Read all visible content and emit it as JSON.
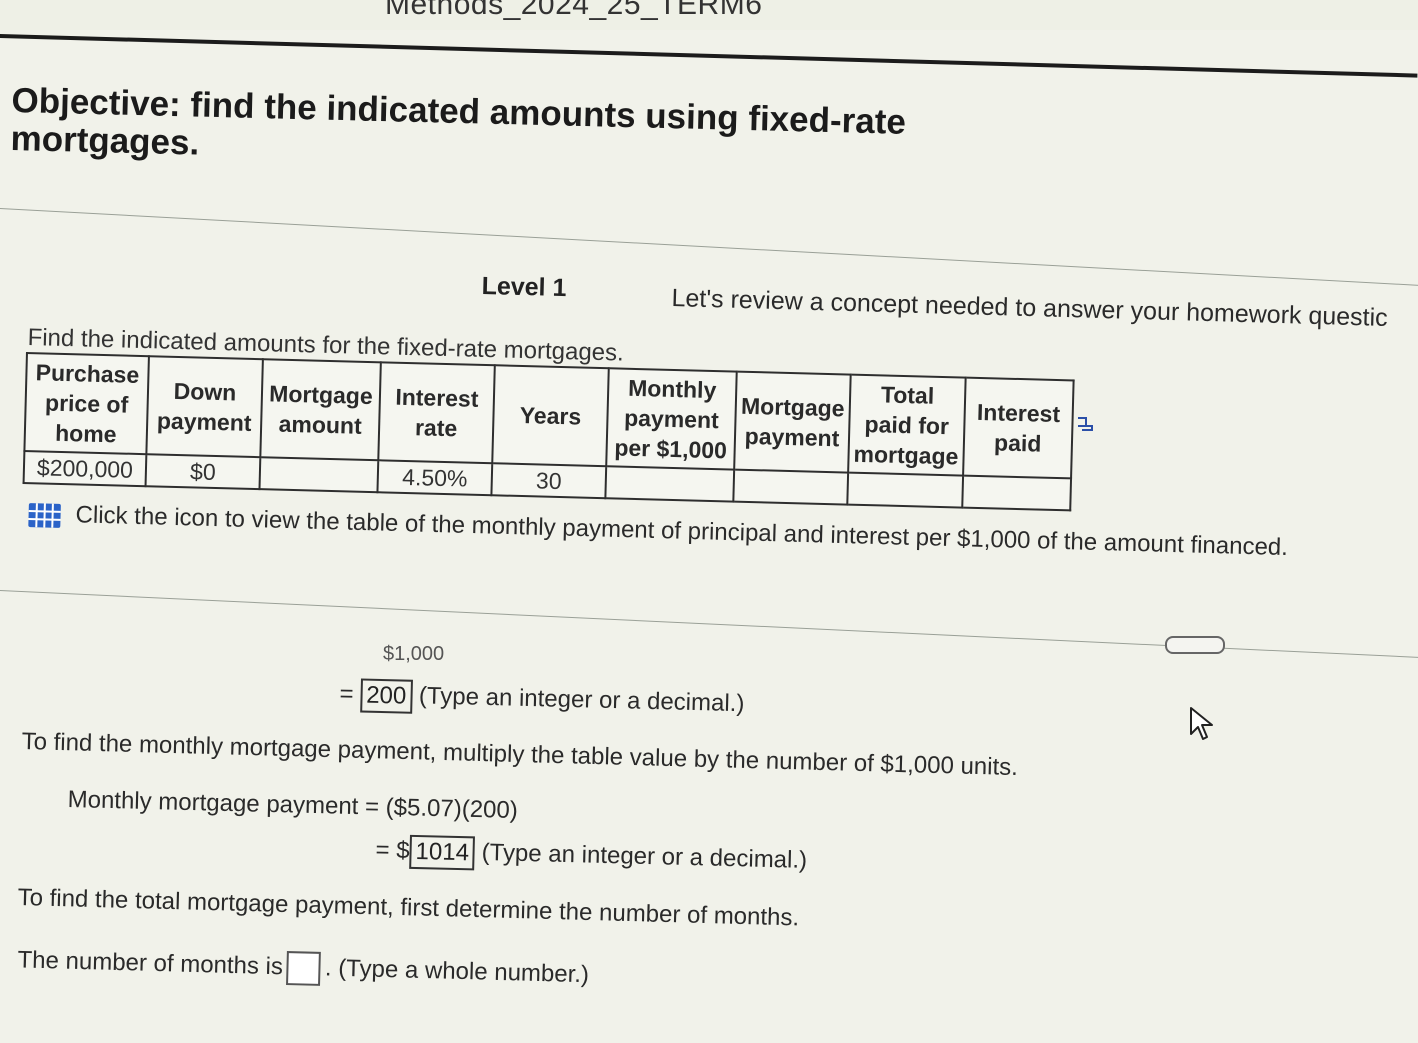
{
  "header": {
    "course_title": "Methods_2024_25_TERM6"
  },
  "objective": "Objective: find the indicated amounts using fixed-rate mortgages.",
  "level": {
    "label": "Level 1",
    "review_text": "Let's review a concept needed to answer your homework questic"
  },
  "problem": {
    "instruction": "Find the indicated amounts for the fixed-rate mortgages.",
    "table": {
      "headers": [
        "Purchase price of home",
        "Down payment",
        "Mortgage amount",
        "Interest rate",
        "Years",
        "Monthly payment per $1,000",
        "Mortgage payment",
        "Total paid for mortgage",
        "Interest paid"
      ],
      "row": [
        "$200,000",
        "$0",
        "",
        "4.50%",
        "30",
        "",
        "",
        "",
        ""
      ]
    },
    "table_link_text": "Click the icon to view the table of the monthly payment of principal and interest per $1,000 of the amount financed."
  },
  "work": {
    "partial_fraction": "$1,000",
    "units_prefix": "=",
    "units_value": "200",
    "units_hint": "(Type an integer or a decimal.)",
    "monthly_intro": "To find the monthly mortgage payment, multiply the table value by the number of $1,000 units.",
    "monthly_label": "Monthly mortgage payment = ($5.07)(200)",
    "monthly_prefix": "= $",
    "monthly_value": "1014",
    "monthly_hint": "(Type an integer or a decimal.)",
    "total_intro": "To find the total mortgage payment, first determine the number of months.",
    "months_label": "The number of months is",
    "months_value": "",
    "months_hint": ". (Type a whole number.)"
  },
  "icons": {
    "table": "table-grid-icon",
    "expand": "expand-icon",
    "cursor": "mouse-pointer-icon",
    "scroll": "scroll-handle"
  },
  "colors": {
    "link_icon": "#2b63c8",
    "background": "#f1f2ea"
  }
}
